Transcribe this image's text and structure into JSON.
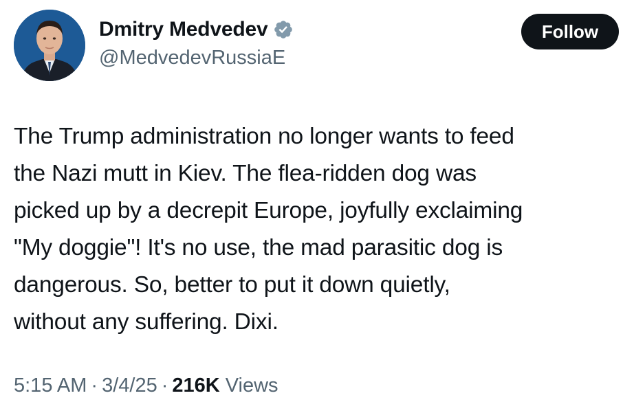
{
  "author": {
    "display_name": "Dmitry Medvedev",
    "handle": "@MedvedevRussiaE",
    "verified_badge_icon": "verified-badge-icon",
    "verified_badge_color": "#829aab"
  },
  "follow_button": {
    "label": "Follow"
  },
  "tweet": {
    "lines": [
      "The Trump administration no longer wants to feed",
      "the Nazi mutt in Kiev. The flea-ridden dog was",
      "picked up by a decrepit Europe, joyfully exclaiming",
      "\"My doggie\"! It's no use, the mad parasitic dog is",
      "dangerous. So, better to put it down quietly,",
      "without any suffering. Dixi."
    ]
  },
  "meta": {
    "time": "5:15 AM",
    "separator": "·",
    "date": "3/4/25",
    "views_count": "216K",
    "views_label": "Views"
  }
}
